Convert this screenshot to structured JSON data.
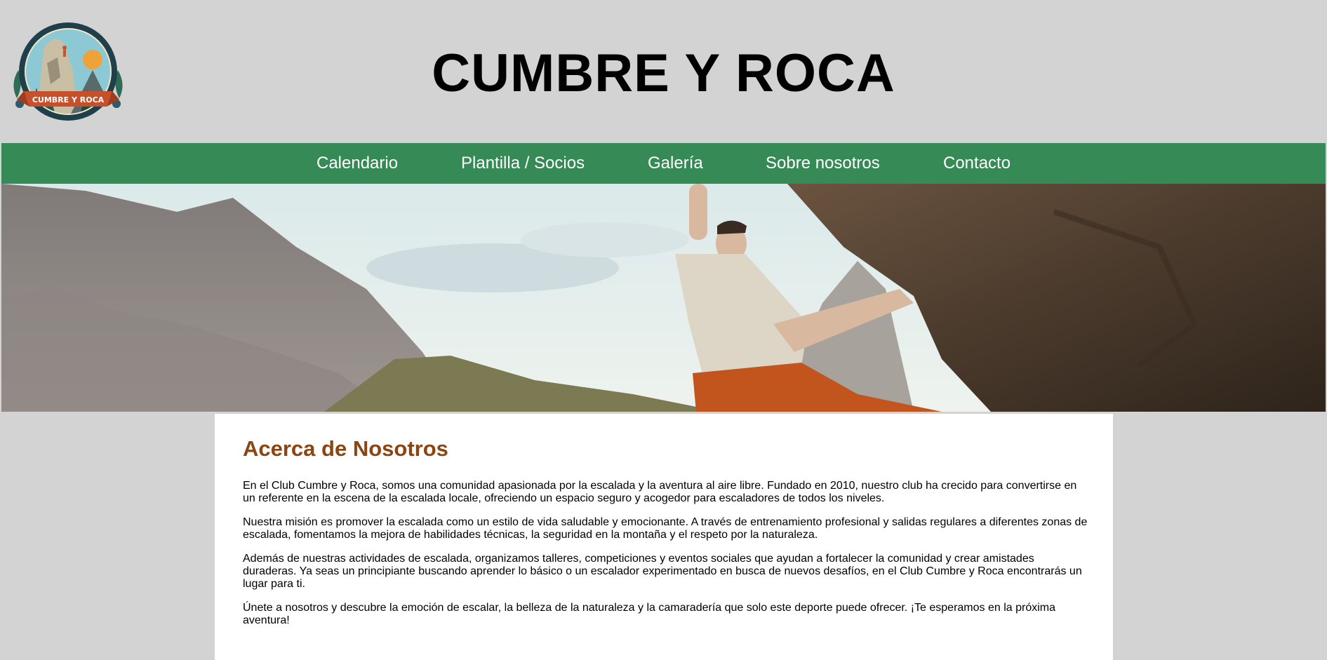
{
  "header": {
    "title": "CUMBRE Y ROCA",
    "logo_text": "CUMBRE Y ROCA"
  },
  "nav": {
    "items": [
      {
        "label": "Calendario"
      },
      {
        "label": "Plantilla / Socios"
      },
      {
        "label": "Galería"
      },
      {
        "label": "Sobre nosotros"
      },
      {
        "label": "Contacto"
      }
    ]
  },
  "hero": {
    "icon": "hero-climbing-photo"
  },
  "about": {
    "heading": "Acerca de Nosotros",
    "paragraphs": [
      "En el Club Cumbre y Roca, somos una comunidad apasionada por la escalada y la aventura al aire libre. Fundado en 2010, nuestro club ha crecido para convertirse en un referente en la escena de la escalada locale, ofreciendo un espacio seguro y acogedor para escaladores de todos los niveles.",
      "Nuestra misión es promover la escalada como un estilo de vida saludable y emocionante. A través de entrenamiento profesional y salidas regulares a diferentes zonas de escalada, fomentamos la mejora de habilidades técnicas, la seguridad en la montaña y el respeto por la naturaleza.",
      "Además de nuestras actividades de escalada, organizamos talleres, competiciones y eventos sociales que ayudan a fortalecer la comunidad y crear amistades duraderas. Ya seas un principiante buscando aprender lo básico o un escalador experimentado en busca de nuevos desafíos, en el Club Cumbre y Roca encontrarás un lugar para ti.",
      "Únete a nosotros y descubre la emoción de escalar, la belleza de la naturaleza y la camaradería que solo este deporte puede ofrecer. ¡Te esperamos en la próxima aventura!"
    ]
  },
  "colors": {
    "page_background": "#d3d3d3",
    "nav_background": "#358a56",
    "heading_color": "#8b4513"
  }
}
